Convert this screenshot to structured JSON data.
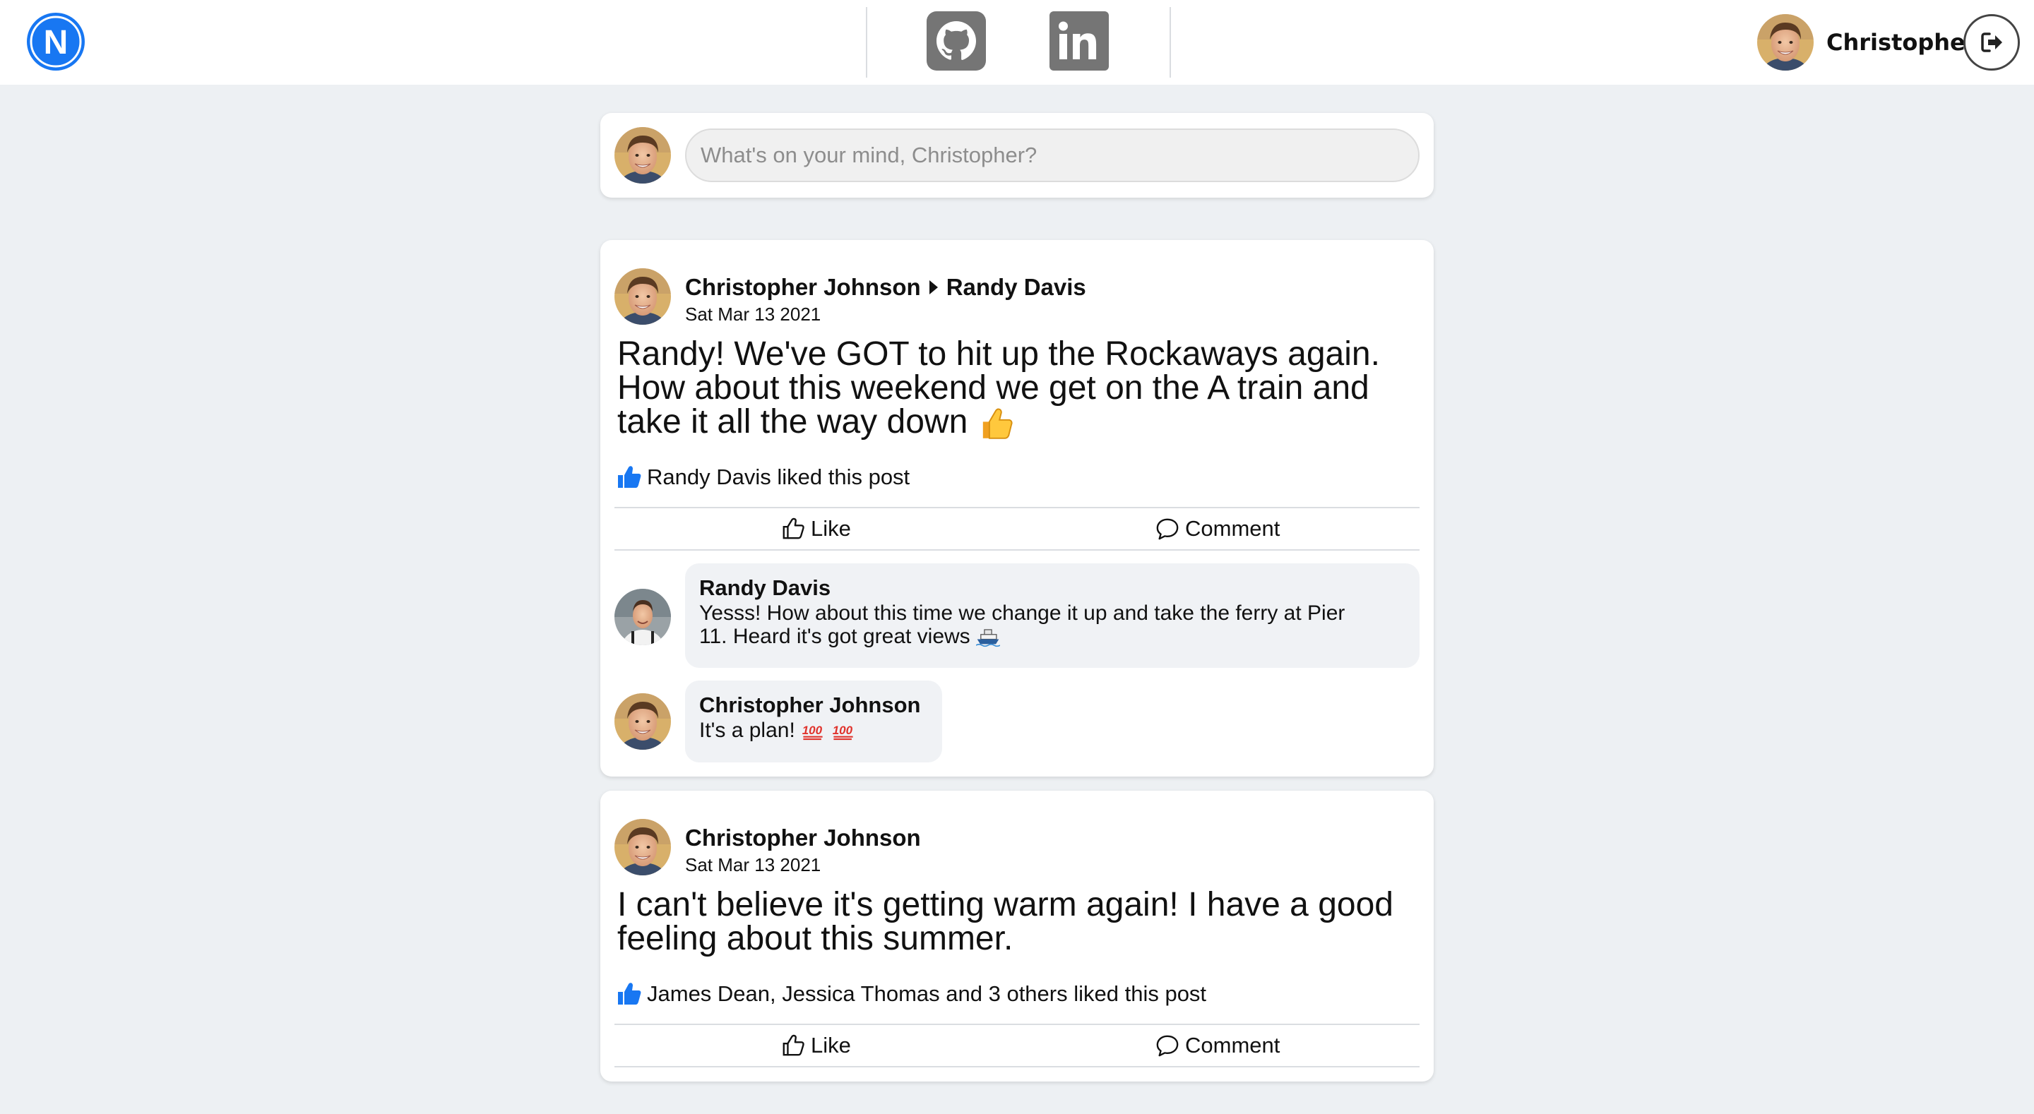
{
  "nav": {
    "logo_letter": "N",
    "user_name": "Christopher",
    "icons": [
      "github-icon",
      "linkedin-icon",
      "logout-icon"
    ]
  },
  "composer": {
    "placeholder": "What's on your mind, Christopher?"
  },
  "posts": [
    {
      "author": "Christopher Johnson",
      "recipient": "Randy Davis",
      "date": "Sat Mar 13 2021",
      "body_line1": "Randy! We've GOT to hit up the Rockaways again.",
      "body_line2": "How about this weekend we get on the A train and",
      "body_line3": "take it all the way down",
      "likes_text": "Randy Davis liked this post",
      "like_label": "Like",
      "comment_label": "Comment",
      "comments": [
        {
          "author": "Randy Davis",
          "text_line1": "Yesss! How about this time we change it up and take the ferry at Pier",
          "text_line2": "11. Heard it's got great views"
        },
        {
          "author": "Christopher Johnson",
          "text": "It's a plan!"
        }
      ]
    },
    {
      "author": "Christopher Johnson",
      "date": "Sat Mar 13 2021",
      "body_line1": "I can't believe it's getting warm again! I have a good",
      "body_line2": "feeling about this summer.",
      "likes_text": "James Dean, Jessica Thomas and 3 others liked this post",
      "like_label": "Like",
      "comment_label": "Comment"
    }
  ],
  "colors": {
    "brand": "#1877f2",
    "background": "#edf0f3",
    "bubble": "#f0f2f5",
    "icon_grey": "#757575"
  }
}
